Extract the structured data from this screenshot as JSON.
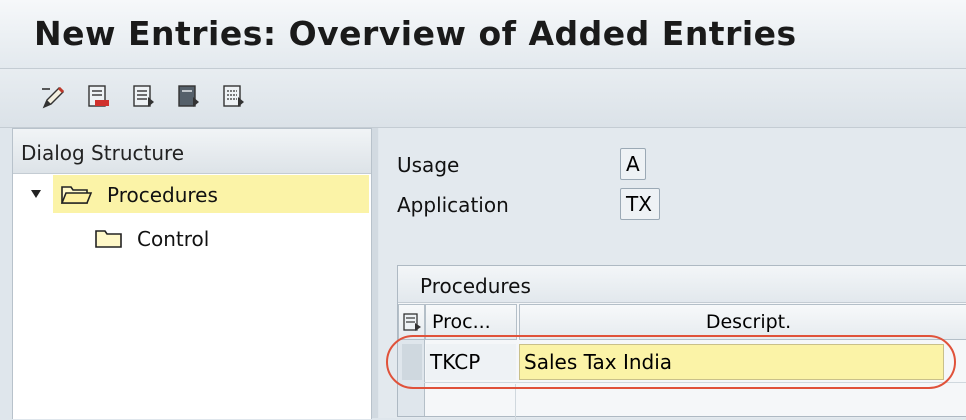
{
  "title": "New Entries: Overview of Added Entries",
  "toolbar": {
    "buttons": [
      {
        "name": "change-display-icon"
      },
      {
        "name": "delete-entry-icon"
      },
      {
        "name": "select-all-icon"
      },
      {
        "name": "select-block-icon"
      },
      {
        "name": "deselect-all-icon"
      }
    ]
  },
  "dialog_structure": {
    "header": "Dialog Structure",
    "items": [
      {
        "label": "Procedures",
        "selected": true,
        "expanded": true
      },
      {
        "label": "Control",
        "selected": false
      }
    ]
  },
  "fields": {
    "usage_label": "Usage",
    "usage_value": "A",
    "application_label": "Application",
    "application_value": "TX"
  },
  "procedures_table": {
    "title": "Procedures",
    "columns": [
      "Proc...",
      "Descript."
    ],
    "rows": [
      {
        "procedure": "TKCP",
        "description": "Sales Tax India"
      }
    ]
  },
  "colors": {
    "selected_row": "#fbf3a7",
    "highlight_ellipse": "#e0523a"
  }
}
